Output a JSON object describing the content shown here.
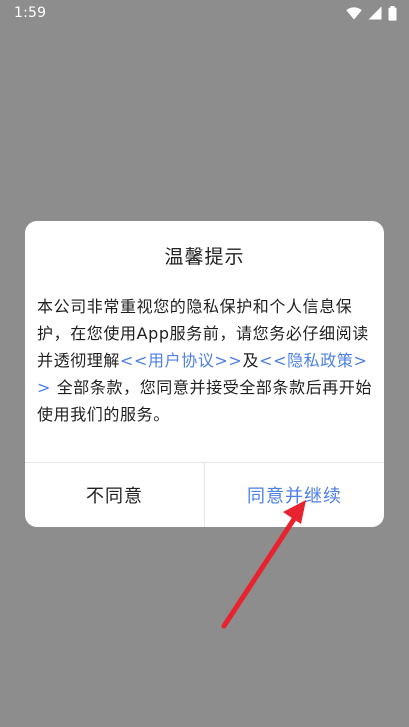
{
  "status_bar": {
    "time": "1:59",
    "icons": [
      "wifi-icon",
      "cellular-signal-icon",
      "battery-icon"
    ]
  },
  "dialog": {
    "title": "温馨提示",
    "body": {
      "text_before_user_agreement": "本公司非常重视您的隐私保护和个人信息保护，在您使用App服务前，请您务必仔细阅读并透彻理解",
      "user_agreement_link": "<<用户协议>>",
      "text_between": "及",
      "privacy_policy_link": "<<隐私政策>>",
      "text_after": " 全部条款，您同意并接受全部条款后再开始使用我们的服务。"
    },
    "buttons": {
      "disagree_label": "不同意",
      "agree_label": "同意并继续"
    }
  },
  "colors": {
    "overlay_background": "#8d8d8d",
    "dialog_background": "#ffffff",
    "link": "#4d7fe6",
    "annotation_arrow": "#e8222e"
  }
}
